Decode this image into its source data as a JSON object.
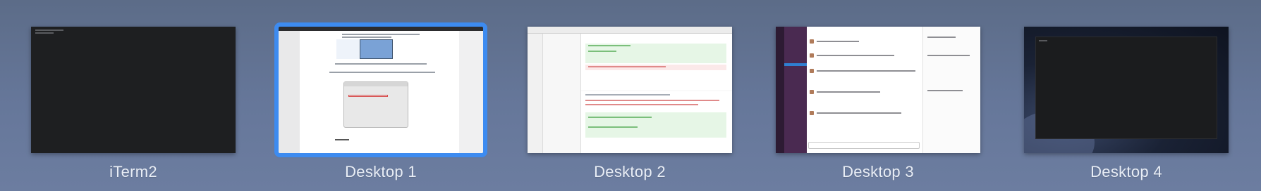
{
  "spaces": [
    {
      "label": "iTerm2",
      "selected": false
    },
    {
      "label": "Desktop 1",
      "selected": true
    },
    {
      "label": "Desktop 2",
      "selected": false
    },
    {
      "label": "Desktop 3",
      "selected": false
    },
    {
      "label": "Desktop 4",
      "selected": false
    }
  ],
  "colors": {
    "background": "#66779a",
    "selection_outline": "#3d8bf0",
    "label_text": "#e9eef6"
  }
}
